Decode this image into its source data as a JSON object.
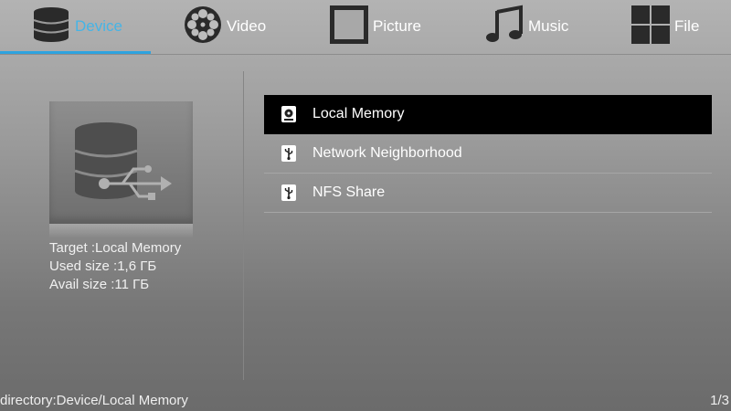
{
  "tabs": [
    {
      "label": "Device",
      "icon": "database-icon",
      "active": true
    },
    {
      "label": "Video",
      "icon": "film-reel-icon",
      "active": false
    },
    {
      "label": "Picture",
      "icon": "picture-frame-icon",
      "active": false
    },
    {
      "label": "Music",
      "icon": "music-note-icon",
      "active": false
    },
    {
      "label": "File",
      "icon": "grid-icon",
      "active": false
    }
  ],
  "device_info": {
    "thumbnail_icon": "database-usb-icon",
    "target": "Target :Local Memory",
    "used": "Used size :1,6 ГБ",
    "avail": "Avail size :11 ГБ"
  },
  "list": [
    {
      "label": "Local Memory",
      "icon": "disk-drive-icon",
      "selected": true
    },
    {
      "label": "Network Neighborhood",
      "icon": "usb-drive-icon",
      "selected": false
    },
    {
      "label": "NFS Share",
      "icon": "usb-drive-icon",
      "selected": false
    }
  ],
  "status": {
    "directory": "directory:Device/Local Memory",
    "page": "1/3"
  },
  "colors": {
    "accent": "#2ea3df",
    "active_tab_text": "#46b4e6",
    "selected_row": "#000000"
  }
}
